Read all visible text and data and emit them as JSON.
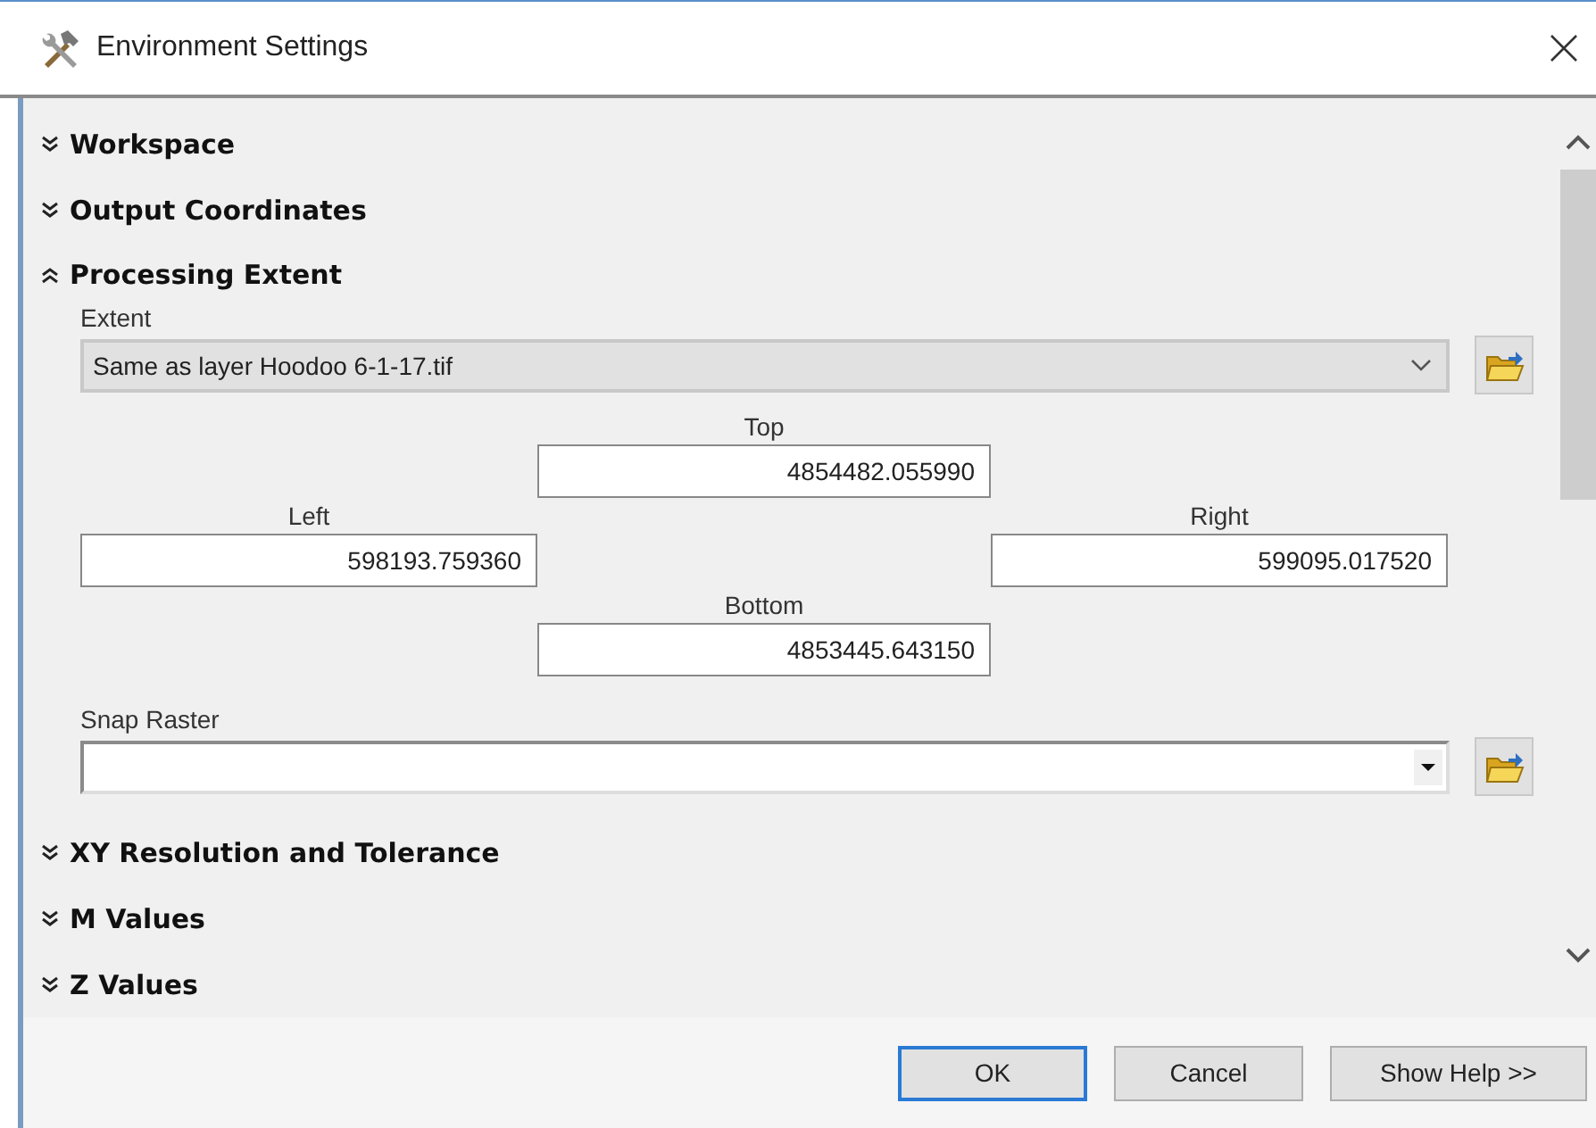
{
  "window": {
    "title": "Environment Settings"
  },
  "sections": [
    {
      "title": "Workspace",
      "expanded": false
    },
    {
      "title": "Output Coordinates",
      "expanded": false
    },
    {
      "title": "Processing Extent",
      "expanded": true,
      "content": {
        "extent": {
          "label": "Extent",
          "value": "Same as layer Hoodoo 6-1-17.tif"
        },
        "coordinates": {
          "top": {
            "label": "Top",
            "value": "4854482.055990"
          },
          "left": {
            "label": "Left",
            "value": "598193.759360"
          },
          "right": {
            "label": "Right",
            "value": "599095.017520"
          },
          "bottom": {
            "label": "Bottom",
            "value": "4853445.643150"
          }
        },
        "snap_raster": {
          "label": "Snap Raster"
        }
      }
    },
    {
      "title": "XY Resolution and Tolerance",
      "expanded": false
    },
    {
      "title": "M Values",
      "expanded": false
    },
    {
      "title": "Z Values",
      "expanded": false
    }
  ],
  "buttons": [
    {
      "label": "OK",
      "default": true
    },
    {
      "label": "Cancel",
      "default": false
    },
    {
      "label": "Show Help >>",
      "default": false
    }
  ]
}
